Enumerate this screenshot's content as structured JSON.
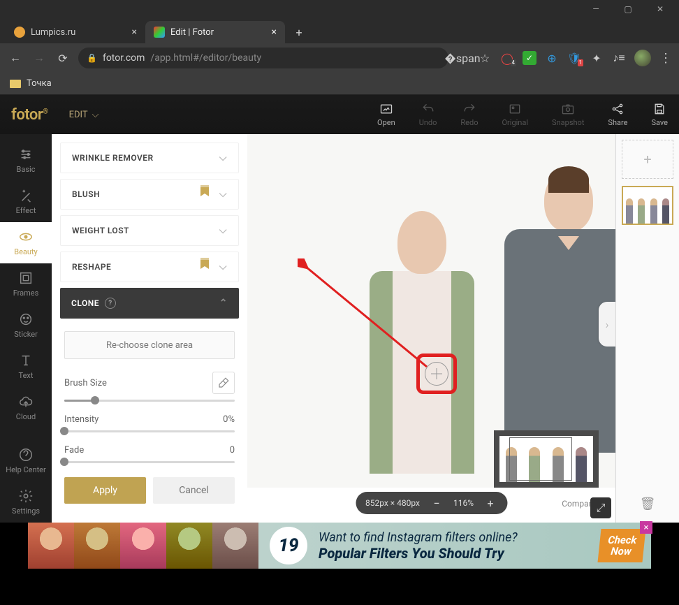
{
  "window": {
    "min": "—",
    "max": "▢",
    "close": "✕"
  },
  "tabs": {
    "t1": {
      "label": "Lumpics.ru",
      "fav_color": "#e8a23c"
    },
    "t2": {
      "label": "Edit | Fotor"
    },
    "new": "+"
  },
  "addr": {
    "back": "←",
    "forward": "→",
    "reload": "⟳",
    "url_host": "fotor.com",
    "url_path": "/app.html#/editor/beauty"
  },
  "ext_badges": {
    "opera": "4",
    "bitwarden": "1"
  },
  "bookmarks": {
    "item1": "Точка"
  },
  "header": {
    "logo": "fotor",
    "logo_r": "®",
    "edit": "EDIT",
    "actions": {
      "open": "Open",
      "undo": "Undo",
      "redo": "Redo",
      "original": "Original",
      "snapshot": "Snapshot",
      "share": "Share",
      "save": "Save"
    }
  },
  "rail": {
    "basic": "Basic",
    "effect": "Effect",
    "beauty": "Beauty",
    "frames": "Frames",
    "sticker": "Sticker",
    "text": "Text",
    "cloud": "Cloud",
    "help": "Help Center",
    "settings": "Settings"
  },
  "tools": {
    "wrinkle": "WRINKLE REMOVER",
    "blush": "BLUSH",
    "weight": "WEIGHT LOST",
    "reshape": "RESHAPE",
    "clone": "CLONE"
  },
  "clone": {
    "rechoose": "Re-choose clone area",
    "brush_label": "Brush Size",
    "intensity_label": "Intensity",
    "intensity_val": "0%",
    "fade_label": "Fade",
    "fade_val": "0",
    "apply": "Apply",
    "cancel": "Cancel",
    "brush_pct": 18,
    "intensity_pct": 0,
    "fade_pct": 0
  },
  "zoom": {
    "dims": "852px × 480px",
    "level": "116%",
    "compare": "Compare"
  },
  "ad": {
    "num": "19",
    "line1": "Want to find Instagram filters online?",
    "line2": "Popular Filters You Should Try",
    "cta1": "Check",
    "cta2": "Now"
  }
}
